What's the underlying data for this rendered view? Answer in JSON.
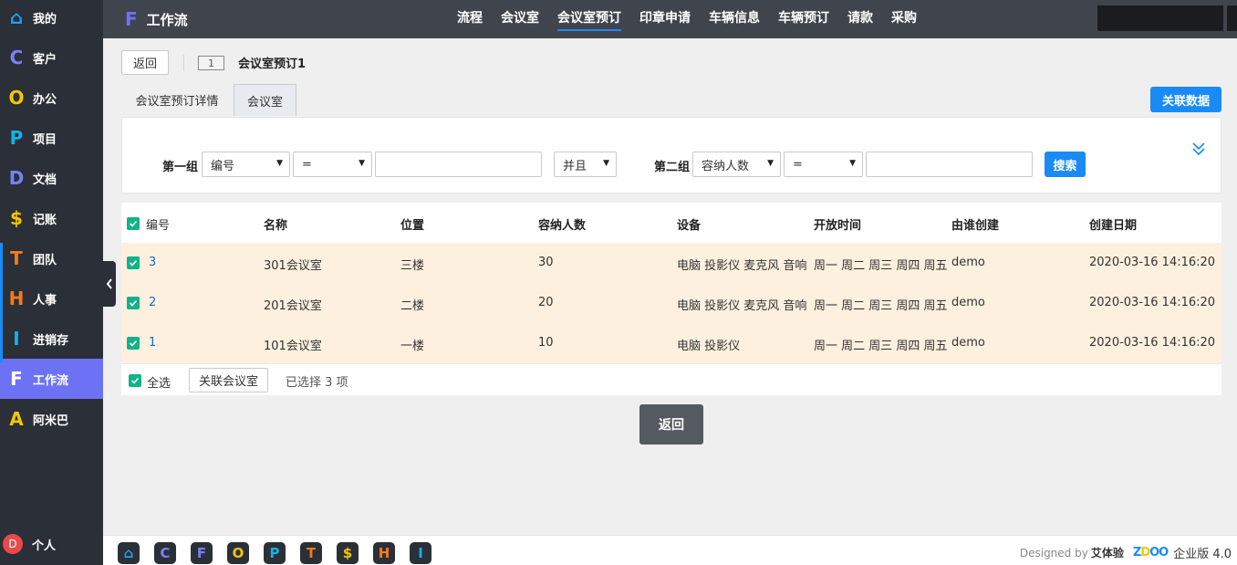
{
  "sidebar": {
    "items": [
      {
        "icon": "home-icon",
        "glyph": "⌂",
        "color": "#1ea1f5",
        "label": "我的"
      },
      {
        "icon": "c-icon",
        "glyph": "C",
        "color": "#7c80f7",
        "label": "客户"
      },
      {
        "icon": "o-icon",
        "glyph": "O",
        "color": "#f5c600",
        "label": "办公"
      },
      {
        "icon": "p-icon",
        "glyph": "P",
        "color": "#12b3e8",
        "label": "项目"
      },
      {
        "icon": "d-icon",
        "glyph": "D",
        "color": "#7c80f7",
        "label": "文档"
      },
      {
        "icon": "dollar-icon",
        "glyph": "$",
        "color": "#f5c600",
        "label": "记账"
      },
      {
        "icon": "t-icon",
        "glyph": "T",
        "color": "#f57a1a",
        "label": "团队"
      },
      {
        "icon": "h-icon",
        "glyph": "H",
        "color": "#f57a1a",
        "label": "人事"
      },
      {
        "icon": "i-icon",
        "glyph": "I",
        "color": "#12b3e8",
        "label": "进销存"
      },
      {
        "icon": "f-icon",
        "glyph": "F",
        "color": "#ffffff",
        "label": "工作流"
      },
      {
        "icon": "a-icon",
        "glyph": "A",
        "color": "#f5c600",
        "label": "阿米巴"
      }
    ],
    "personal": {
      "avatar": "D",
      "label": "个人"
    }
  },
  "topbar": {
    "app_glyph": "F",
    "app_title": "工作流",
    "nav": [
      "流程",
      "会议室",
      "会议室预订",
      "印章申请",
      "车辆信息",
      "车辆预订",
      "请款",
      "采购"
    ],
    "active_nav": "会议室预订"
  },
  "header": {
    "back_label": "返回",
    "id": "1",
    "title": "会议室预订1"
  },
  "tabs": {
    "detail": "会议室预订详情",
    "room": "会议室",
    "related_button": "关联数据"
  },
  "search": {
    "group1_label": "第一组",
    "group1_field": "编号",
    "group1_op": "=",
    "group1_value": "",
    "andor": "并且",
    "group2_label": "第二组",
    "group2_field": "容纳人数",
    "group2_op": "=",
    "group2_value": "",
    "search_button": "搜索"
  },
  "table": {
    "columns": [
      "编号",
      "名称",
      "位置",
      "容纳人数",
      "设备",
      "开放时间",
      "由谁创建",
      "创建日期"
    ],
    "rows": [
      {
        "id": "3",
        "name": "301会议室",
        "location": "三楼",
        "capacity": "30",
        "equipment": "电脑 投影仪 麦克风 音响",
        "open": "周一 周二 周三 周四 周五",
        "creator": "demo",
        "created": "2020-03-16 14:16:20"
      },
      {
        "id": "2",
        "name": "201会议室",
        "location": "二楼",
        "capacity": "20",
        "equipment": "电脑 投影仪 麦克风 音响",
        "open": "周一 周二 周三 周四 周五",
        "creator": "demo",
        "created": "2020-03-16 14:16:20"
      },
      {
        "id": "1",
        "name": "101会议室",
        "location": "一楼",
        "capacity": "10",
        "equipment": "电脑 投影仪",
        "open": "周一 周二 周三 周四 周五",
        "creator": "demo",
        "created": "2020-03-16 14:16:20"
      }
    ],
    "select_all": "全选",
    "link_button": "关联会议室",
    "selected_text": "已选择 3 项"
  },
  "back_main_label": "返回",
  "bottombar": {
    "dock": [
      {
        "icon": "home-icon",
        "glyph": "⌂",
        "color": "#1ea1f5"
      },
      {
        "icon": "c-icon",
        "glyph": "C",
        "color": "#7c80f7"
      },
      {
        "icon": "f-icon",
        "glyph": "F",
        "color": "#7c80f7"
      },
      {
        "icon": "o-icon",
        "glyph": "O",
        "color": "#f5c600"
      },
      {
        "icon": "p-icon",
        "glyph": "P",
        "color": "#12b3e8"
      },
      {
        "icon": "t-icon",
        "glyph": "T",
        "color": "#f57a1a"
      },
      {
        "icon": "dollar-icon",
        "glyph": "$",
        "color": "#f5c600"
      },
      {
        "icon": "h-icon",
        "glyph": "H",
        "color": "#f57a1a"
      },
      {
        "icon": "i-icon",
        "glyph": "I",
        "color": "#12b3e8"
      }
    ],
    "designed_by": "Designed by",
    "brand": "艾体验",
    "logo_part1": "Z",
    "logo_part2": "D",
    "logo_part3": "OO",
    "edition": "企业版 4.0"
  }
}
